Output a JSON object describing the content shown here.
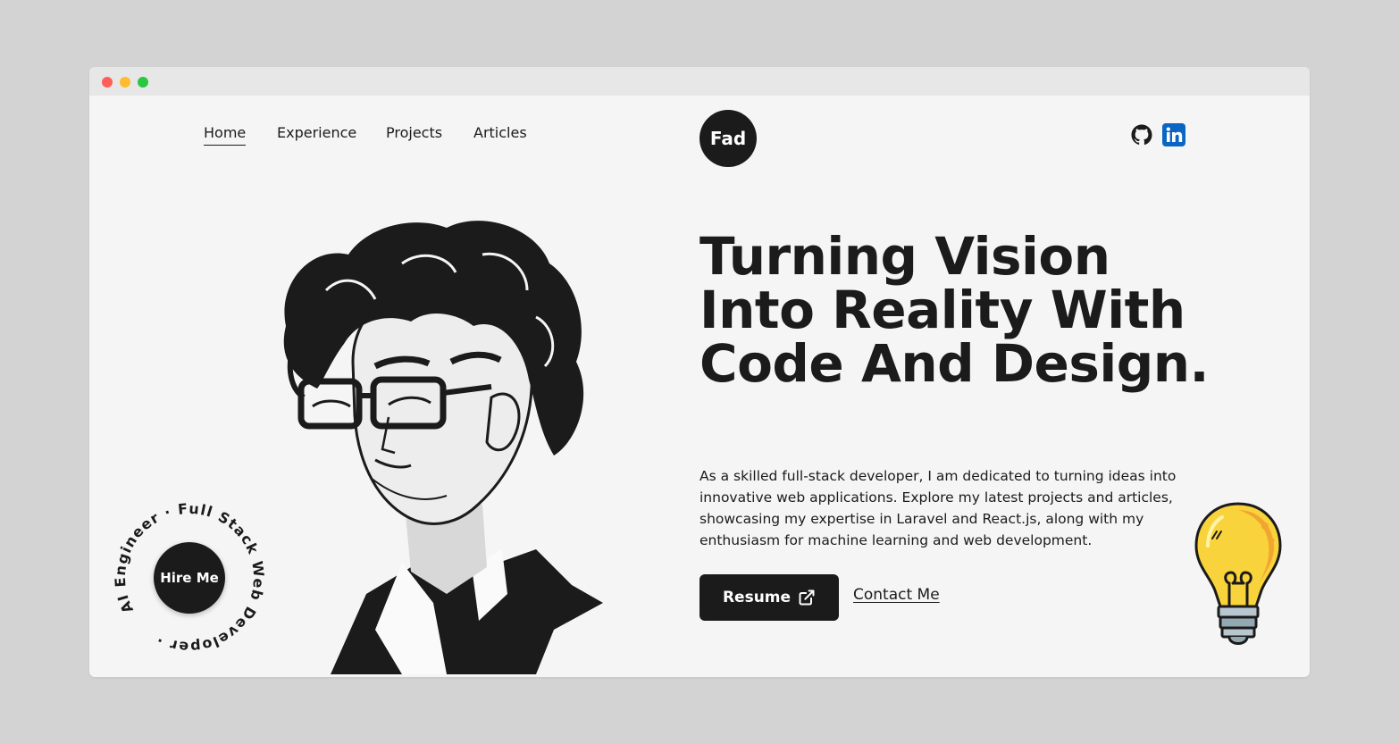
{
  "window": {
    "controls": [
      "close",
      "minimize",
      "maximize"
    ]
  },
  "nav": {
    "items": [
      {
        "label": "Home",
        "active": true
      },
      {
        "label": "Experience",
        "active": false
      },
      {
        "label": "Projects",
        "active": false
      },
      {
        "label": "Articles",
        "active": false
      }
    ]
  },
  "logo": {
    "text": "Fad"
  },
  "social": {
    "icons": [
      "github-icon",
      "linkedin-icon"
    ]
  },
  "hero": {
    "headline": "Turning Vision Into Reality With Code And Design.",
    "description": "As a skilled full-stack developer, I am dedicated to turning ideas into innovative web applications. Explore my latest projects and articles, showcasing my expertise in Laravel and React.js, along with my enthusiasm for machine learning and web development.",
    "resume_label": "Resume",
    "contact_label": "Contact Me"
  },
  "hire": {
    "label": "Hire Me",
    "ring_text": "AI Engineer · Full Stack Web Developer · "
  },
  "colors": {
    "background": "#f5f5f5",
    "dark": "#1b1b1b",
    "linkedin": "#0a66c2",
    "bulb": "#f9d33b"
  }
}
